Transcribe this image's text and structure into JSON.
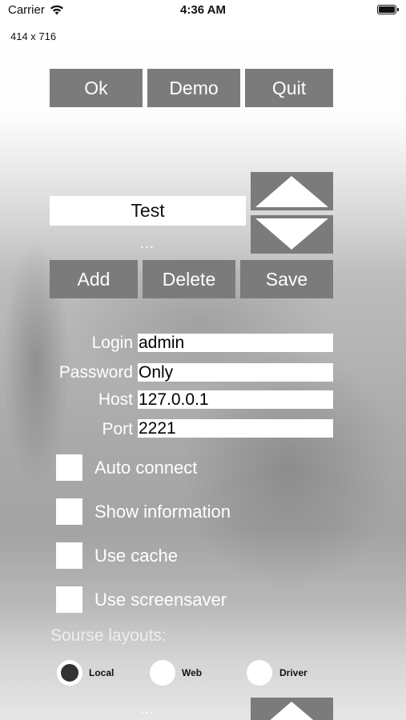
{
  "status_bar": {
    "carrier": "Carrier",
    "time": "4:36 AM"
  },
  "screen_size": "414 x 716",
  "top_buttons": {
    "ok": "Ok",
    "demo": "Demo",
    "quit": "Quit"
  },
  "list": {
    "current_item": "Test",
    "more": "...",
    "more_bottom": "..."
  },
  "list_buttons": {
    "add": "Add",
    "delete": "Delete",
    "save": "Save"
  },
  "form": {
    "login": {
      "label": "Login",
      "value": "admin"
    },
    "password": {
      "label": "Password",
      "value": "Only"
    },
    "host": {
      "label": "Host",
      "value": "127.0.0.1"
    },
    "port": {
      "label": "Port",
      "value": "2221"
    }
  },
  "options": [
    {
      "label": "Auto connect",
      "checked": false
    },
    {
      "label": "Show information",
      "checked": false
    },
    {
      "label": "Use cache",
      "checked": false
    },
    {
      "label": "Use screensaver",
      "checked": false
    }
  ],
  "source_layouts": {
    "title": "Sourse layouts:",
    "options": [
      {
        "label": "Local",
        "selected": true
      },
      {
        "label": "Web",
        "selected": false
      },
      {
        "label": "Driver",
        "selected": false
      }
    ]
  },
  "icons": [
    "wifi-icon",
    "battery-icon",
    "up-arrow-icon",
    "down-arrow-icon"
  ],
  "colors": {
    "button": "#7b7b7b",
    "button_text": "#ffffff",
    "field": "#ffffff",
    "radio_selected": "#333333"
  }
}
